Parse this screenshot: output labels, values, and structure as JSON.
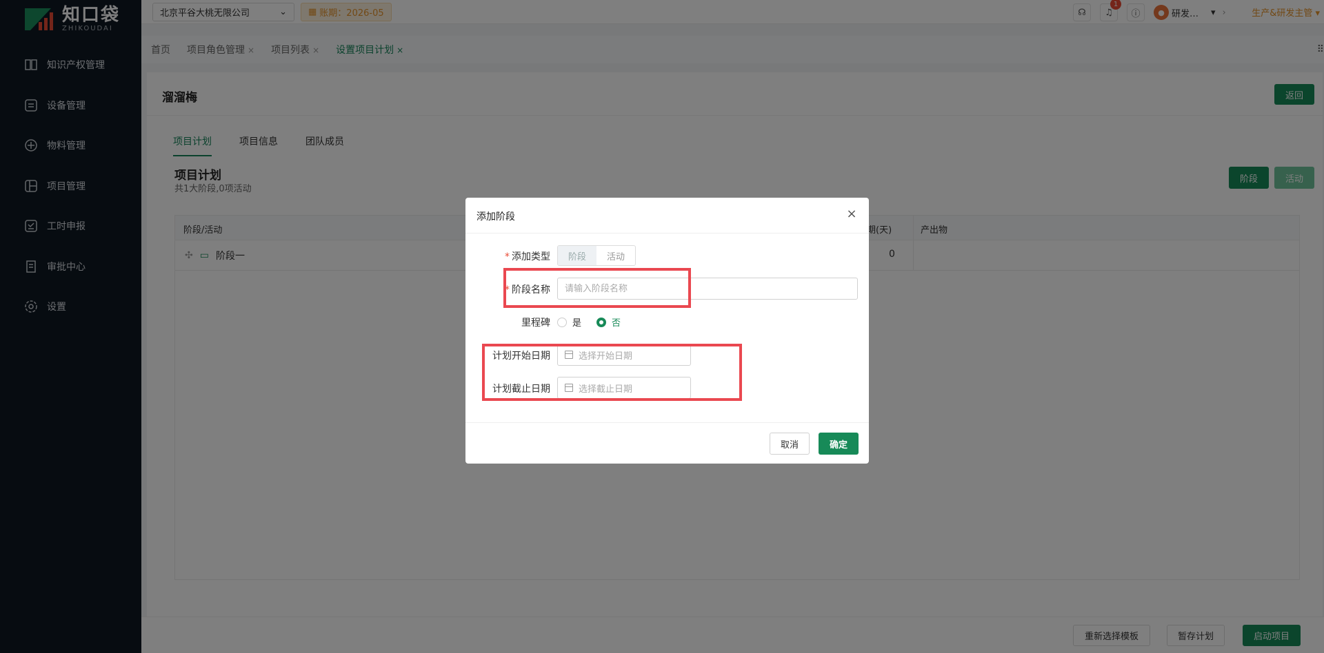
{
  "sidebar": {
    "logo_cn": "知口袋",
    "logo_en": "ZHIKOUDAI",
    "items": [
      {
        "label": "知识产权管理",
        "icon": "book-icon"
      },
      {
        "label": "设备管理",
        "icon": "device-icon"
      },
      {
        "label": "物料管理",
        "icon": "material-icon"
      },
      {
        "label": "项目管理",
        "icon": "project-icon"
      },
      {
        "label": "工时申报",
        "icon": "timesheet-icon"
      },
      {
        "label": "审批中心",
        "icon": "approval-icon"
      },
      {
        "label": "设置",
        "icon": "gear-icon"
      }
    ]
  },
  "topbar": {
    "company": "北京平谷大桃无限公司",
    "period": "账期：2026-05",
    "notifications": "1",
    "user": "研发…",
    "role": "生产&研发主管"
  },
  "tabs": [
    {
      "label": "首页",
      "closable": false
    },
    {
      "label": "项目角色管理",
      "closable": true
    },
    {
      "label": "项目列表",
      "closable": true
    },
    {
      "label": "设置项目计划",
      "closable": true,
      "active": true
    }
  ],
  "page": {
    "title": "溜溜梅",
    "back": "返回",
    "sub_tabs": [
      "项目计划",
      "项目信息",
      "团队成员"
    ],
    "plan_title": "项目计划",
    "plan_summary": "共1大阶段,0项活动",
    "stage_btn": "阶段",
    "activity_btn": "活动",
    "columns": {
      "stage_activity": "阶段/活动",
      "duration": "期(天)",
      "output": "产出物"
    },
    "rows": [
      {
        "name": "阶段一",
        "duration": "0"
      }
    ]
  },
  "footer": {
    "reselect": "重新选择模板",
    "save_draft": "暂存计划",
    "start": "启动项目"
  },
  "modal": {
    "title": "添加阶段",
    "type_label": "添加类型",
    "type_options": [
      "阶段",
      "活动"
    ],
    "name_label": "阶段名称",
    "name_placeholder": "请输入阶段名称",
    "milestone_label": "里程碑",
    "milestone_yes": "是",
    "milestone_no": "否",
    "start_label": "计划开始日期",
    "start_placeholder": "选择开始日期",
    "end_label": "计划截止日期",
    "end_placeholder": "选择截止日期",
    "cancel": "取消",
    "confirm": "确定"
  },
  "colors": {
    "brand": "#178a58",
    "highlight": "#ea4850",
    "warning": "#e5932b"
  }
}
